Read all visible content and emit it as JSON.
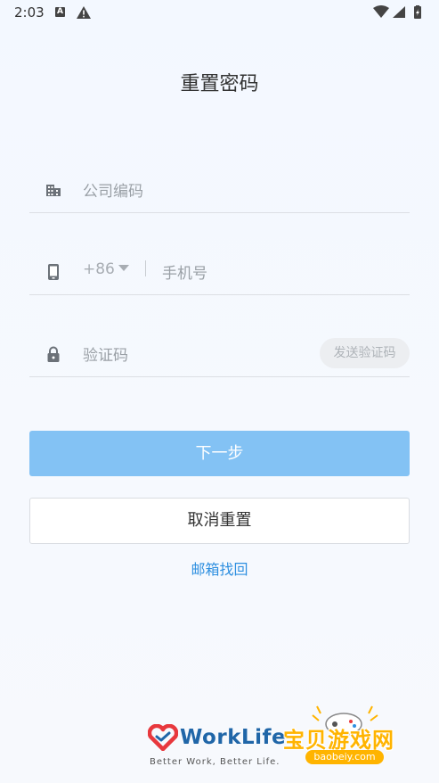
{
  "status_bar": {
    "time": "2:03",
    "notif_letter": "A"
  },
  "page": {
    "title": "重置密码"
  },
  "form": {
    "company_placeholder": "公司编码",
    "country_code": "+86",
    "phone_placeholder": "手机号",
    "code_placeholder": "验证码",
    "send_code_label": "发送验证码"
  },
  "actions": {
    "next_label": "下一步",
    "cancel_label": "取消重置",
    "email_link": "邮箱找回"
  },
  "brand": {
    "name": "WorkLife",
    "tagline": "Better Work, Better Life."
  },
  "watermark": {
    "text": "宝贝游戏网",
    "url": "baobeiy.com"
  },
  "colors": {
    "primary_button": "#83c2f4",
    "link": "#2d8fe0",
    "logo_red": "#e8383d",
    "logo_blue": "#2066a8"
  }
}
